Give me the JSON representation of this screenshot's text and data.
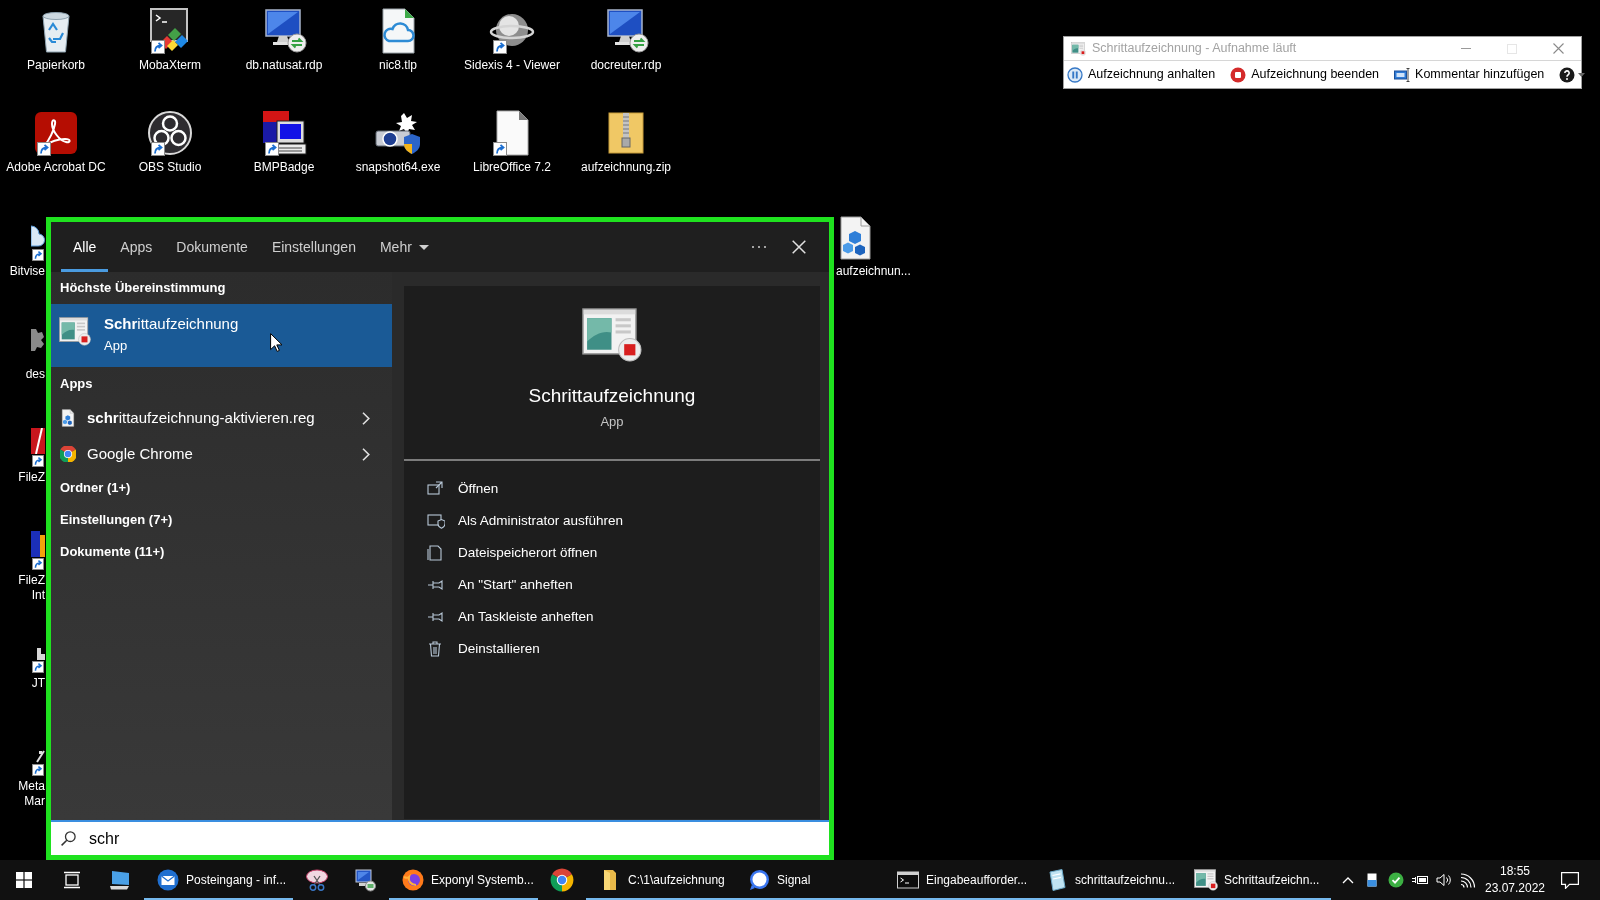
{
  "desktop": {
    "icons": [
      {
        "label": "Papierkorb",
        "kind": "recycle-bin",
        "shortcut": false
      },
      {
        "label": "MobaXterm",
        "kind": "terminal",
        "shortcut": true
      },
      {
        "label": "db.natusat.rdp",
        "kind": "remote-desktop",
        "shortcut": false
      },
      {
        "label": "nic8.tlp",
        "kind": "cloud-file",
        "shortcut": false
      },
      {
        "label": "Sidexis 4 - Viewer",
        "kind": "sphere",
        "shortcut": true
      },
      {
        "label": "docreuter.rdp",
        "kind": "remote-desktop",
        "shortcut": false
      },
      {
        "label": "Adobe Acrobat DC",
        "kind": "pdf",
        "shortcut": true
      },
      {
        "label": "OBS Studio",
        "kind": "obs",
        "shortcut": true
      },
      {
        "label": "BMPBadge",
        "kind": "led-computer",
        "shortcut": true
      },
      {
        "label": "snapshot64.exe",
        "kind": "camera-shield",
        "shortcut": false
      },
      {
        "label": "LibreOffice 7.2",
        "kind": "document",
        "shortcut": true
      },
      {
        "label": "aufzeichnung.zip",
        "kind": "zip-folder",
        "shortcut": false
      }
    ],
    "partly_hidden_icons": [
      {
        "label_lines": [
          "Bitvise"
        ],
        "kind": "cloud",
        "shortcut": true
      },
      {
        "label_lines": [
          "des"
        ],
        "kind": "gear",
        "shortcut": false
      },
      {
        "label_lines": [
          "FileZ"
        ],
        "kind": "tile",
        "shortcut": true
      },
      {
        "label_lines": [
          "FileZ",
          "Int"
        ],
        "kind": "window",
        "shortcut": true
      },
      {
        "label_lines": [
          "JT"
        ],
        "kind": "box",
        "shortcut": true
      },
      {
        "label_lines": [
          "Meta",
          "Mar"
        ],
        "kind": "stylus",
        "shortcut": true
      }
    ],
    "right_icon": {
      "label": "aufzeichnun...",
      "kind": "registry-file"
    }
  },
  "recorder_window": {
    "title": "Schrittaufzeichnung - Aufnahme läuft",
    "toolbar": [
      {
        "label": "Aufzeichnung anhalten",
        "kind": "pause"
      },
      {
        "label": "Aufzeichnung beenden",
        "kind": "stop"
      },
      {
        "label": "Kommentar hinzufügen",
        "kind": "comment"
      },
      {
        "kind": "help"
      }
    ]
  },
  "search_panel": {
    "tabs": [
      {
        "label": "Alle",
        "selected": true,
        "dropdown": false
      },
      {
        "label": "Apps",
        "selected": false,
        "dropdown": false
      },
      {
        "label": "Dokumente",
        "selected": false,
        "dropdown": false
      },
      {
        "label": "Einstellungen",
        "selected": false,
        "dropdown": false
      },
      {
        "label": "Mehr",
        "selected": false,
        "dropdown": true
      }
    ],
    "best_match": {
      "heading": "Höchste Übereinstimmung",
      "title": "**Schr**ittaufzeichnung",
      "subtitle": "App",
      "selected": true
    },
    "apps": {
      "heading": "Apps",
      "items": [
        {
          "label": "**schr**ittaufzeichnung-aktivieren.reg",
          "kind": "registry-file",
          "selected": false
        },
        {
          "label": "Google Chrome",
          "kind": "chrome",
          "selected": false
        }
      ]
    },
    "groups": [
      "Ordner (1+)",
      "Einstellungen (7+)",
      "Dokumente (11+)"
    ],
    "detail": {
      "title": "Schrittaufzeichnung",
      "subtitle": "App",
      "actions": [
        {
          "label": "Öffnen",
          "kind": "open"
        },
        {
          "label": "Als Administrator ausführen",
          "kind": "admin"
        },
        {
          "label": "Dateispeicherort öffnen",
          "kind": "file-location"
        },
        {
          "label": "An \"Start\" anheften",
          "kind": "pin"
        },
        {
          "label": "An Taskleiste anheften",
          "kind": "pin"
        },
        {
          "label": "Deinstallieren",
          "kind": "uninstall"
        }
      ]
    },
    "search": {
      "value": "schr"
    }
  },
  "taskbar": {
    "buttons": [
      {
        "kind": "start",
        "running": false
      },
      {
        "kind": "task-view",
        "running": false
      },
      {
        "kind": "computer",
        "running": false
      },
      {
        "kind": "mail",
        "label": "Posteingang - inf...",
        "running": true
      },
      {
        "kind": "snipping",
        "running": false
      },
      {
        "kind": "network-computer",
        "running": false
      },
      {
        "kind": "firefox",
        "label": "Exponyl Systemb...",
        "running": true
      },
      {
        "kind": "chrome",
        "running": false
      },
      {
        "kind": "folder",
        "label": "C:\\1\\aufzeichnung",
        "running": true
      },
      {
        "kind": "signal",
        "label": "Signal",
        "running": true
      },
      {
        "kind": "cmd",
        "label": "Eingabeaufforder...",
        "running": true
      },
      {
        "kind": "steps-file",
        "label": "schrittaufzeichnu...",
        "running": true
      },
      {
        "kind": "steps-app",
        "label": "Schrittaufzeichn...",
        "running": true
      }
    ],
    "clock": {
      "time": "18:55",
      "date": "23.07.2022"
    }
  }
}
